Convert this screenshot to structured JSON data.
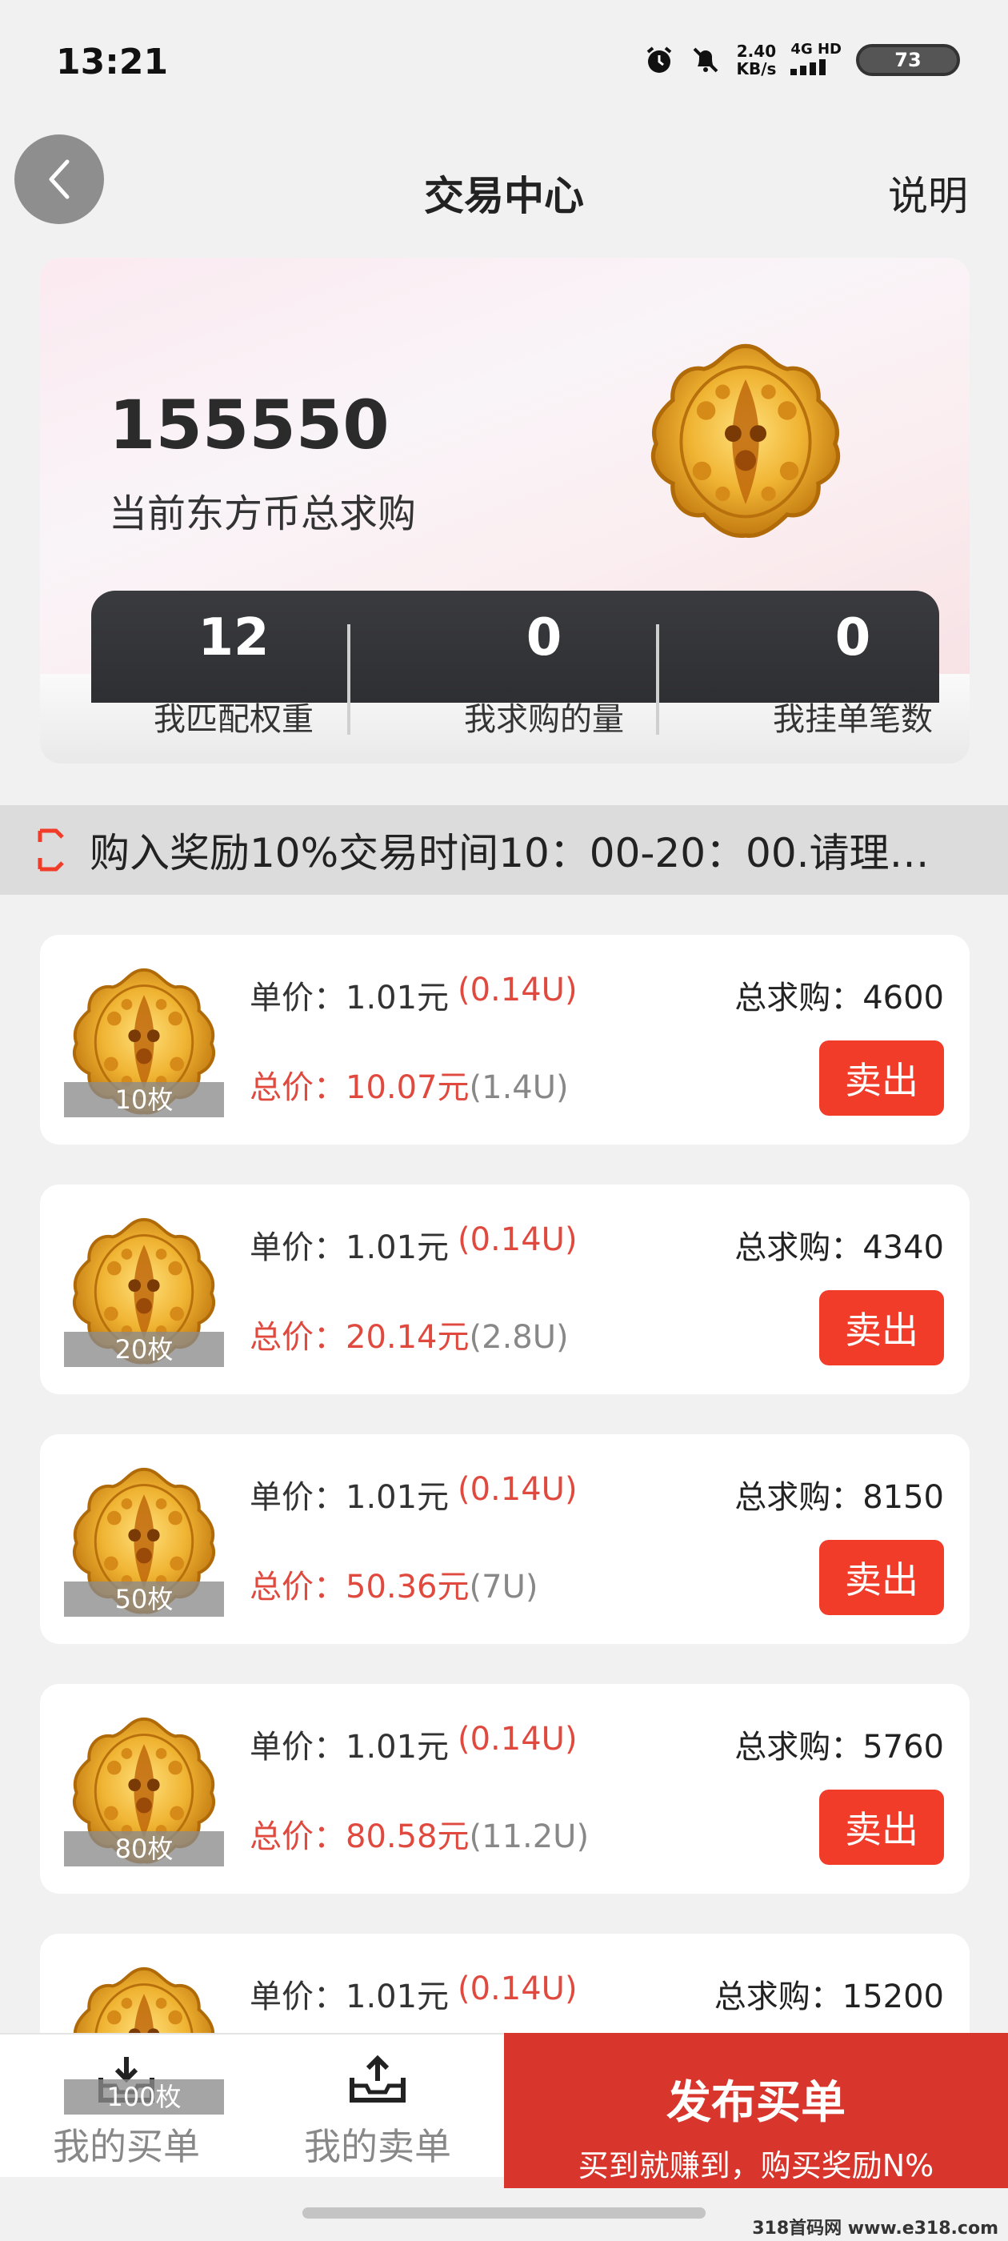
{
  "status_bar": {
    "time": "13:21",
    "net_speed_value": "2.40",
    "net_speed_unit": "KB/s",
    "net_type": "4G HD",
    "battery": "73",
    "icons": [
      "alarm-icon",
      "mute-bell-icon",
      "signal-icon"
    ]
  },
  "header": {
    "title": "交易中心",
    "explain": "说明"
  },
  "hero": {
    "total_value": "155550",
    "total_label": "当前东方币总求购",
    "stats": [
      {
        "value": "12",
        "label": "我匹配权重"
      },
      {
        "value": "0",
        "label": "我求购的量"
      },
      {
        "value": "0",
        "label": "我挂单笔数"
      }
    ]
  },
  "notice": {
    "text": "购入奖励10%交易时间10：00-20：00.请理…"
  },
  "listings": [
    {
      "qty": "10枚",
      "unit_price": "单价：1.01元",
      "unit_u": "(0.14U)",
      "total_prefix": "总价：10.07元",
      "total_u": "(1.4U)",
      "demand": "总求购：4600",
      "action": "卖出"
    },
    {
      "qty": "20枚",
      "unit_price": "单价：1.01元",
      "unit_u": "(0.14U)",
      "total_prefix": "总价：20.14元",
      "total_u": "(2.8U)",
      "demand": "总求购：4340",
      "action": "卖出"
    },
    {
      "qty": "50枚",
      "unit_price": "单价：1.01元",
      "unit_u": "(0.14U)",
      "total_prefix": "总价：50.36元",
      "total_u": "(7U)",
      "demand": "总求购：8150",
      "action": "卖出"
    },
    {
      "qty": "80枚",
      "unit_price": "单价：1.01元",
      "unit_u": "(0.14U)",
      "total_prefix": "总价：80.58元",
      "total_u": "(11.2U)",
      "demand": "总求购：5760",
      "action": "卖出"
    },
    {
      "qty": "100枚",
      "unit_price": "单价：1.01元",
      "unit_u": "(0.14U)",
      "total_prefix": "",
      "total_u": "",
      "demand": "总求购：15200",
      "action": ""
    }
  ],
  "bottom_nav": {
    "my_buy": "我的买单",
    "my_sell": "我的卖单",
    "publish_title": "发布买单",
    "publish_sub": "买到就赚到，购买奖励N%"
  },
  "watermark": "318首码网 www.e318.com",
  "colors": {
    "accent_red": "#f23c2a",
    "publish_red": "#d8362d",
    "price_red": "#e0493e",
    "gold": "#e7a82a"
  }
}
